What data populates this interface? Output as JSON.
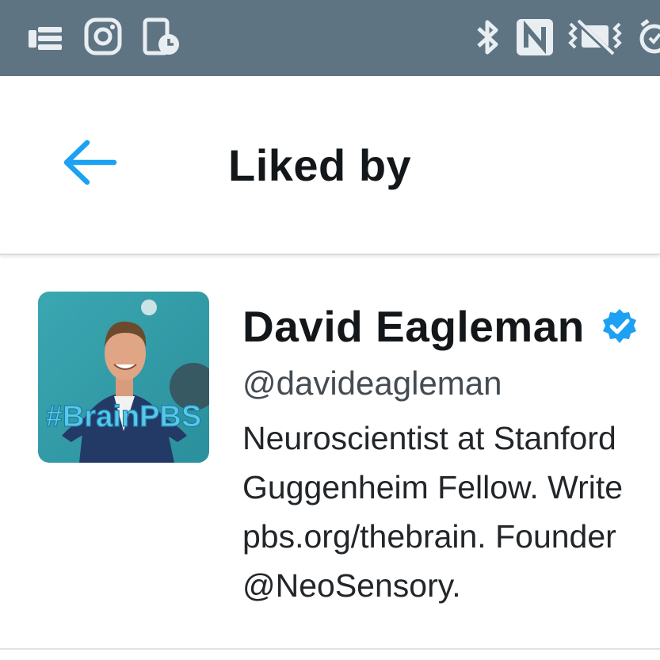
{
  "status_bar": {
    "left_icons": [
      "notification-bars-icon",
      "instagram-icon",
      "device-clock-icon"
    ],
    "right_icons": [
      "bluetooth-icon",
      "nfc-icon",
      "vibrate-icon",
      "alarm-icon"
    ]
  },
  "header": {
    "title": "Liked by",
    "back_icon": "arrow-left-icon"
  },
  "users": [
    {
      "name": "David Eagleman",
      "verified": true,
      "handle": "@davideagleman",
      "bio_lines": [
        "Neuroscientist at Stanford",
        "Guggenheim Fellow. Write",
        "pbs.org/thebrain. Founder",
        "@NeoSensory."
      ],
      "avatar_text": "#BrainPBS"
    }
  ],
  "colors": {
    "status_bar": "#5f7482",
    "accent": "#1da1f2",
    "text": "#14171a"
  }
}
